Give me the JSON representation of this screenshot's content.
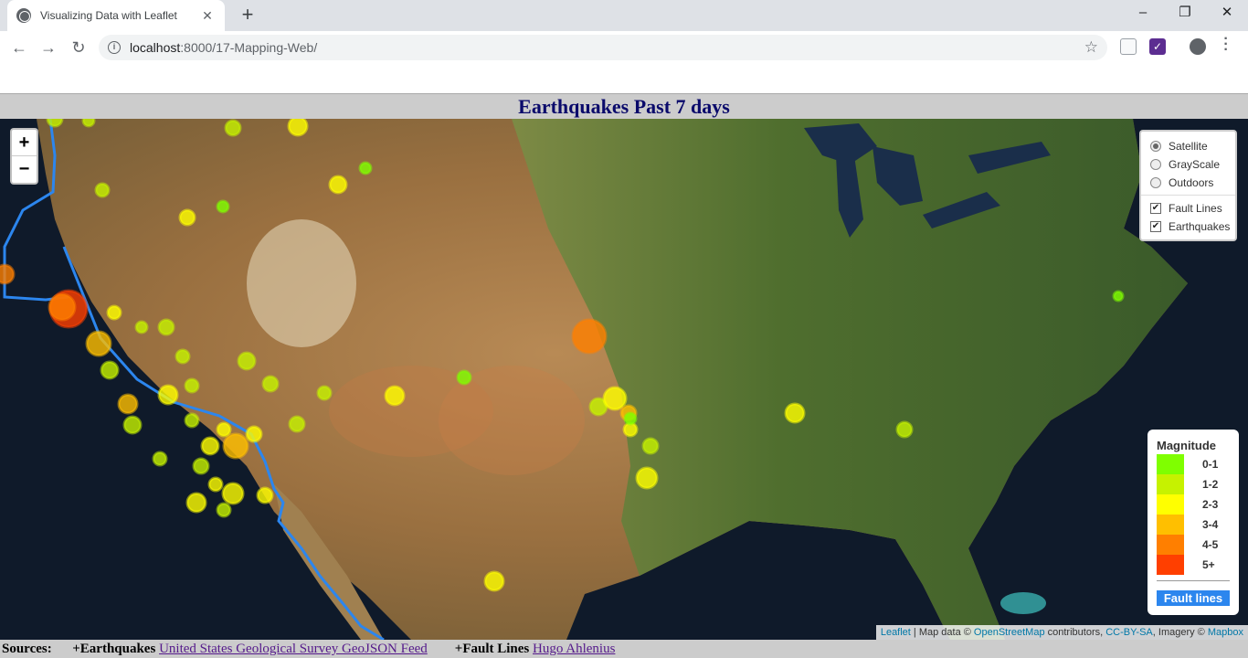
{
  "browser": {
    "tab_title": "Visualizing Data with Leaflet",
    "tab_close": "✕",
    "new_tab": "+",
    "url_host": "localhost",
    "url_rest": ":8000/17-Mapping-Web/",
    "window_controls": [
      "–",
      "❐",
      "✕"
    ],
    "extension_icon_2": "✓"
  },
  "page": {
    "title": "Earthquakes Past 7 days"
  },
  "map": {
    "zoom_in": "+",
    "zoom_out": "−",
    "base_layers": [
      {
        "label": "Satellite",
        "selected": true
      },
      {
        "label": "GrayScale",
        "selected": false
      },
      {
        "label": "Outdoors",
        "selected": false
      }
    ],
    "overlays": [
      {
        "label": "Fault Lines",
        "checked": true
      },
      {
        "label": "Earthquakes",
        "checked": true
      }
    ],
    "legend": {
      "title": "Magnitude",
      "items": [
        {
          "label": "0-1",
          "color": "#7fff00"
        },
        {
          "label": "1-2",
          "color": "#c6f200"
        },
        {
          "label": "2-3",
          "color": "#ffff00"
        },
        {
          "label": "3-4",
          "color": "#ffbf00"
        },
        {
          "label": "4-5",
          "color": "#ff7f00"
        },
        {
          "label": "5+",
          "color": "#ff3f00"
        }
      ],
      "fault_label": "Fault lines",
      "fault_color": "#2c86ee"
    },
    "attribution": {
      "leaflet": "Leaflet",
      "sep1": " | Map data © ",
      "osm": "OpenStreetMap",
      "contrib": " contributors, ",
      "ccbysa": "CC-BY-SA",
      "imagery": ", Imagery © ",
      "mapbox": "Mapbox"
    }
  },
  "sources": {
    "label": "Sources:",
    "eq_label": "+Earthquakes",
    "eq_link": "United States Geological Survey GeoJSON Feed",
    "fault_label": "+Fault Lines",
    "fault_link": "Hugo Ahlenius"
  }
}
